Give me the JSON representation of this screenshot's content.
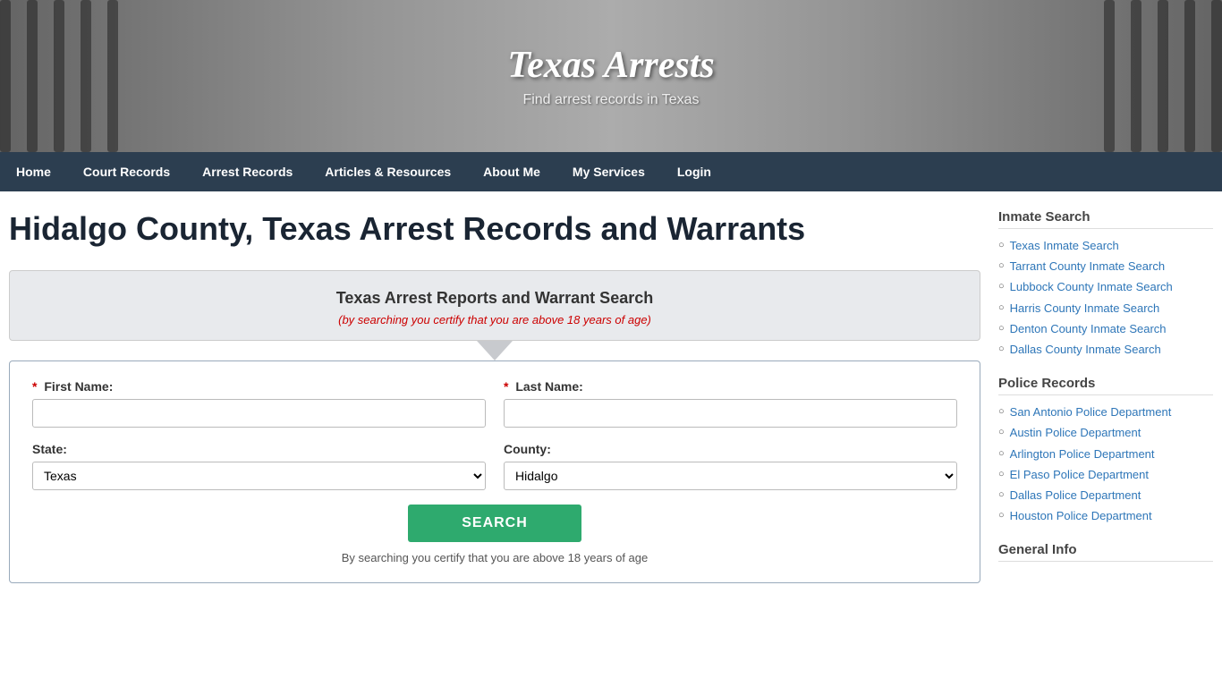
{
  "header": {
    "title": "Texas Arrests",
    "subtitle": "Find arrest records in Texas"
  },
  "navbar": {
    "items": [
      {
        "label": "Home",
        "active": false
      },
      {
        "label": "Court Records",
        "active": false
      },
      {
        "label": "Arrest Records",
        "active": false
      },
      {
        "label": "Articles & Resources",
        "active": false
      },
      {
        "label": "About Me",
        "active": false
      },
      {
        "label": "My Services",
        "active": false
      },
      {
        "label": "Login",
        "active": false
      }
    ]
  },
  "main": {
    "page_heading": "Hidalgo County, Texas Arrest Records and Warrants",
    "search_box": {
      "title": "Texas Arrest Reports and Warrant Search",
      "certify_text": "(by searching you certify that you are above 18 years of age)",
      "first_name_label": "First Name:",
      "last_name_label": "Last Name:",
      "state_label": "State:",
      "county_label": "County:",
      "state_value": "Texas",
      "county_value": "Hidalgo",
      "search_button_label": "SEARCH",
      "footer_note": "By searching you certify that you are above 18 years of age"
    }
  },
  "sidebar": {
    "inmate_search": {
      "title": "Inmate Search",
      "links": [
        "Texas Inmate Search",
        "Tarrant County Inmate Search",
        "Lubbock County Inmate Search",
        "Harris County Inmate Search",
        "Denton County Inmate Search",
        "Dallas County Inmate Search"
      ]
    },
    "police_records": {
      "title": "Police Records",
      "links": [
        "San Antonio Police Department",
        "Austin Police Department",
        "Arlington Police Department",
        "El Paso Police Department",
        "Dallas Police Department",
        "Houston Police Department"
      ]
    },
    "general_info": {
      "title": "General Info"
    }
  }
}
